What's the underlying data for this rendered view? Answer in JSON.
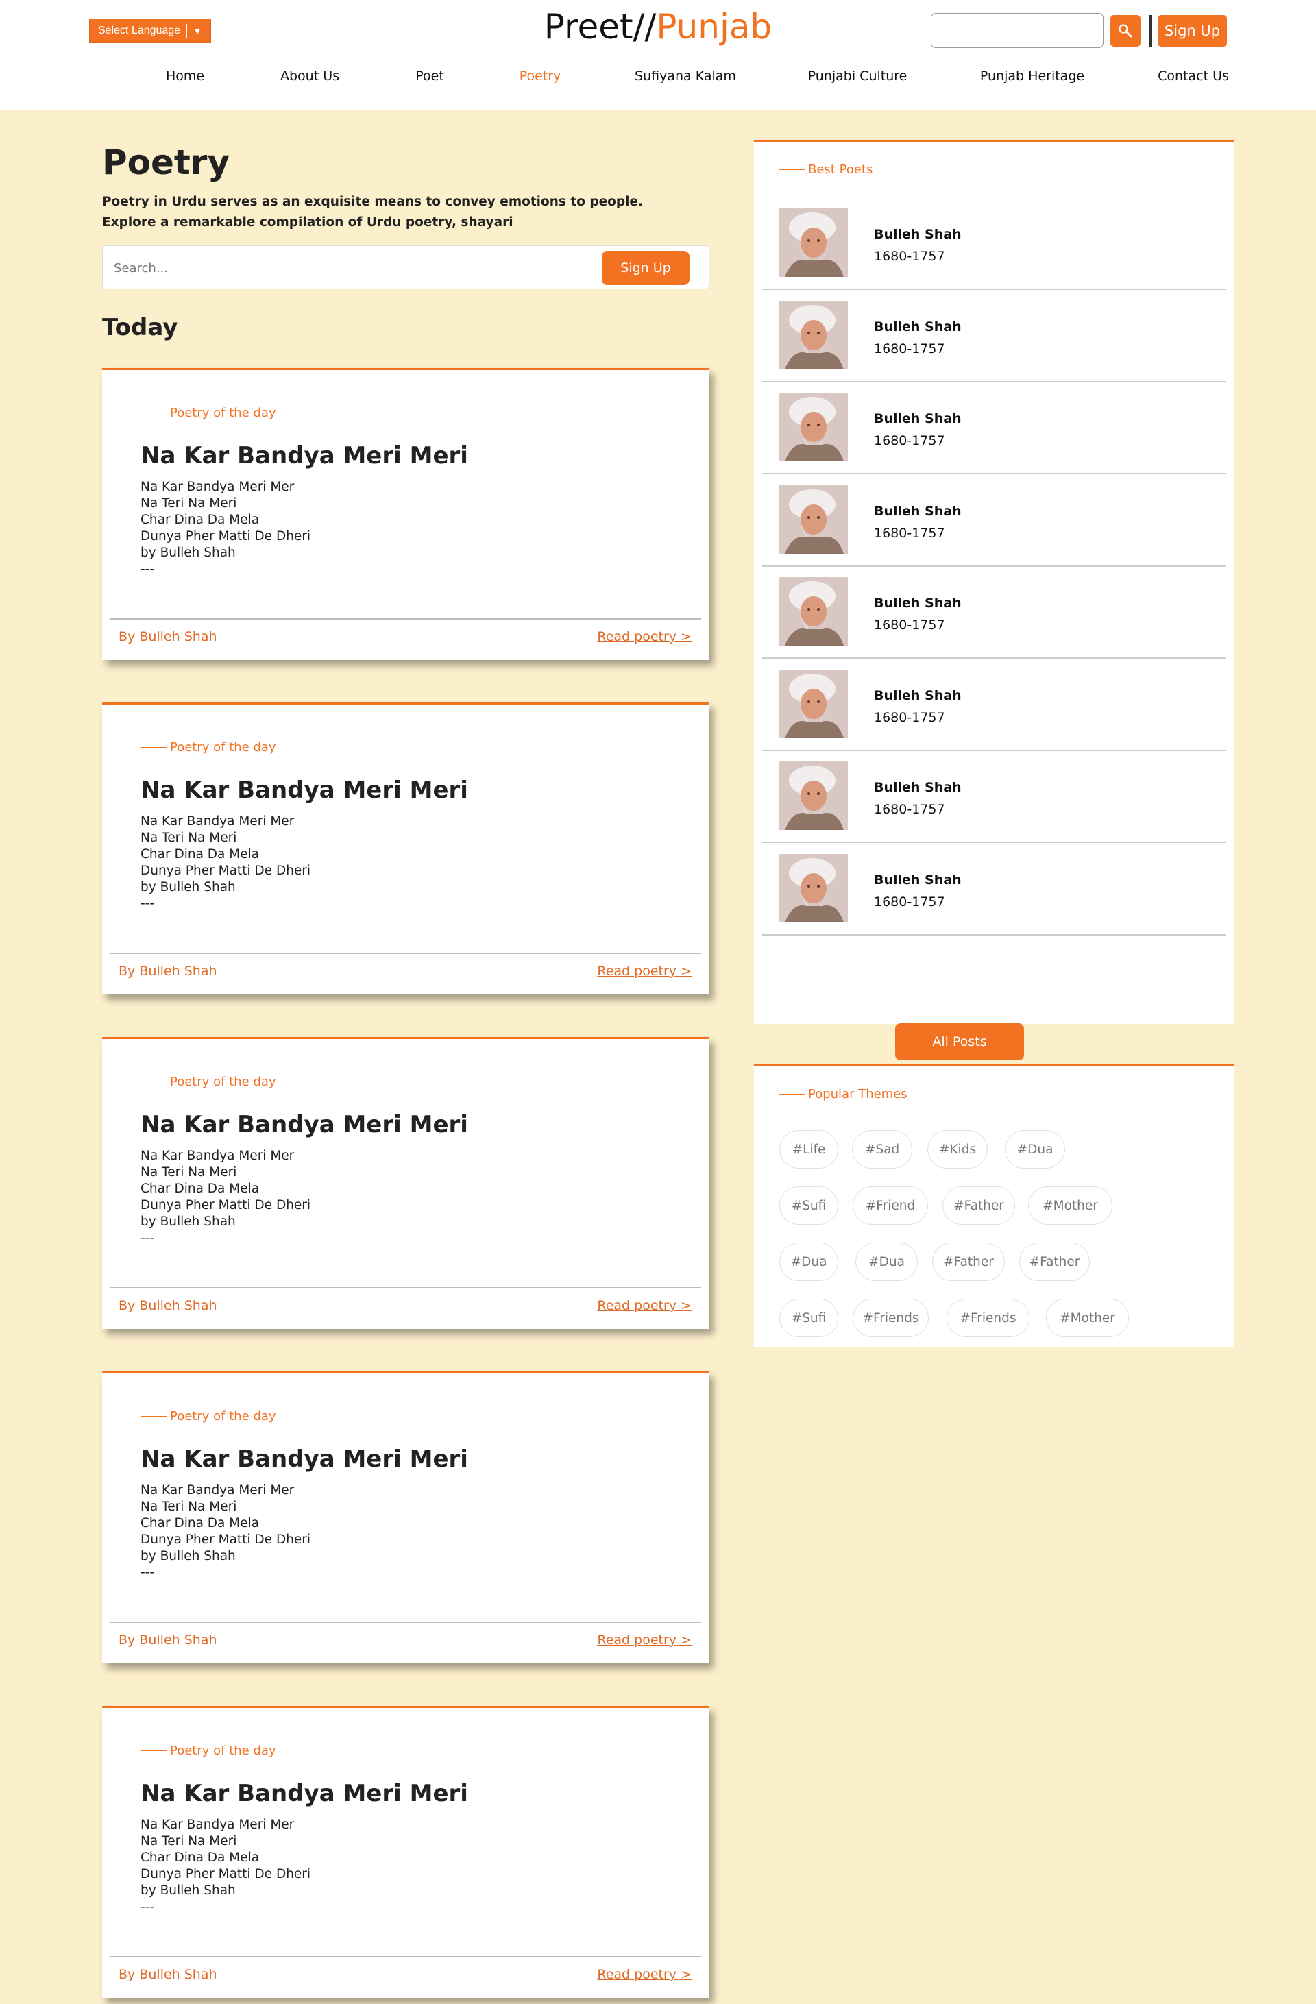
{
  "header": {
    "language_label": "Select Language",
    "logo_main": "Preet//",
    "logo_accent": "Punjab",
    "search_value": "",
    "signup_label": "Sign Up"
  },
  "nav": [
    {
      "label": "Home",
      "active": false
    },
    {
      "label": "About Us",
      "active": false
    },
    {
      "label": "Poet",
      "active": false
    },
    {
      "label": "Poetry",
      "active": true
    },
    {
      "label": "Sufiyana Kalam",
      "active": false
    },
    {
      "label": "Punjabi Culture",
      "active": false
    },
    {
      "label": "Punjab Heritage",
      "active": false
    },
    {
      "label": "Contact Us",
      "active": false
    }
  ],
  "main": {
    "title": "Poetry",
    "description": "Poetry in Urdu serves as an exquisite means to convey emotions to people. Explore a remarkable compilation of Urdu poetry, shayari",
    "search_placeholder": "Search...",
    "search_button": "Sign Up",
    "section_title": "Today"
  },
  "cards": [
    {
      "tag": "Poetry of the day",
      "title": "Na Kar Bandya Meri Meri",
      "lines": [
        "Na Kar Bandya Meri Mer",
        "Na Teri Na Meri",
        "Char Dina Da Mela",
        "Dunya Pher Matti De Dheri",
        "by Bulleh Shah",
        "---"
      ],
      "author": "By Bulleh Shah",
      "read_label": "Read poetry >"
    },
    {
      "tag": "Poetry of the day",
      "title": "Na Kar Bandya Meri Meri",
      "lines": [
        "Na Kar Bandya Meri Mer",
        "Na Teri Na Meri",
        "Char Dina Da Mela",
        "Dunya Pher Matti De Dheri",
        "by Bulleh Shah",
        "---"
      ],
      "author": "By Bulleh Shah",
      "read_label": "Read poetry >"
    },
    {
      "tag": "Poetry of the day",
      "title": "Na Kar Bandya Meri Meri",
      "lines": [
        "Na Kar Bandya Meri Mer",
        "Na Teri Na Meri",
        "Char Dina Da Mela",
        "Dunya Pher Matti De Dheri",
        "by Bulleh Shah",
        "---"
      ],
      "author": "By Bulleh Shah",
      "read_label": "Read poetry >"
    },
    {
      "tag": "Poetry of the day",
      "title": "Na Kar Bandya Meri Meri",
      "lines": [
        "Na Kar Bandya Meri Mer",
        "Na Teri Na Meri",
        "Char Dina Da Mela",
        "Dunya Pher Matti De Dheri",
        "by Bulleh Shah",
        "---"
      ],
      "author": "By Bulleh Shah",
      "read_label": "Read poetry >"
    },
    {
      "tag": "Poetry of the day",
      "title": "Na Kar Bandya Meri Meri",
      "lines": [
        "Na Kar Bandya Meri Mer",
        "Na Teri Na Meri",
        "Char Dina Da Mela",
        "Dunya Pher Matti De Dheri",
        "by Bulleh Shah",
        "---"
      ],
      "author": "By Bulleh Shah",
      "read_label": "Read poetry >"
    }
  ],
  "sidebar": {
    "best_poets_title": "Best Poets",
    "poets": [
      {
        "name": "Bulleh Shah",
        "years": "1680-1757"
      },
      {
        "name": "Bulleh Shah",
        "years": "1680-1757"
      },
      {
        "name": "Bulleh Shah",
        "years": "1680-1757"
      },
      {
        "name": "Bulleh Shah",
        "years": "1680-1757"
      },
      {
        "name": "Bulleh Shah",
        "years": "1680-1757"
      },
      {
        "name": "Bulleh Shah",
        "years": "1680-1757"
      },
      {
        "name": "Bulleh Shah",
        "years": "1680-1757"
      },
      {
        "name": "Bulleh Shah",
        "years": "1680-1757"
      }
    ],
    "all_posts_label": "All Posts",
    "themes_title": "Popular Themes",
    "themes": [
      "#Life",
      "#Sad",
      "#Kids",
      "#Dua",
      "#Sufi",
      "#Friend",
      "#Father",
      "#Mother",
      "#Dua",
      "#Dua",
      "#Father",
      "#Father",
      "#Sufi",
      "#Friends",
      "#Friends",
      "#Mother"
    ]
  },
  "colors": {
    "accent": "#F27222",
    "background": "#FCEFCB"
  },
  "icons": {
    "search": "search-icon",
    "dropdown": "chevron-down-icon"
  }
}
